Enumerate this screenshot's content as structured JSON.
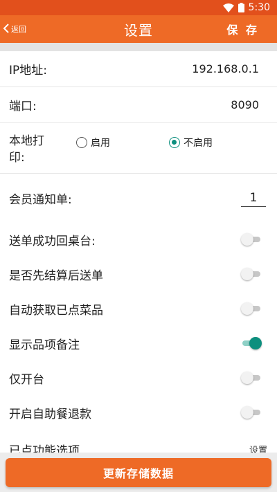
{
  "status_bar": {
    "time": "5:30"
  },
  "nav": {
    "back_label": "返回",
    "title": "设置",
    "save_label": "保 存"
  },
  "settings": {
    "ip": {
      "label": "IP地址:",
      "value": "192.168.0.1"
    },
    "port": {
      "label": "端口:",
      "value": "8090"
    },
    "local_print": {
      "label": "本地打印:",
      "options": [
        {
          "label": "启用",
          "selected": false
        },
        {
          "label": "不启用",
          "selected": true
        }
      ]
    },
    "member_notice": {
      "label": "会员通知单:",
      "value": "1"
    },
    "toggles": [
      {
        "label": "送单成功回桌台:",
        "on": false
      },
      {
        "label": "是否先结算后送单",
        "on": false
      },
      {
        "label": "自动获取已点菜品",
        "on": false
      },
      {
        "label": "显示品项备注",
        "on": true
      },
      {
        "label": "仅开台",
        "on": false
      },
      {
        "label": "开启自助餐退款",
        "on": false
      }
    ],
    "ordered_options": {
      "label": "已点功能选项",
      "action_label": "设置"
    }
  },
  "footer": {
    "update_button_label": "更新存储数据"
  },
  "colors": {
    "brand": "#ee6a26",
    "status_bar": "#e2501c",
    "accent": "#0d8f7e"
  }
}
